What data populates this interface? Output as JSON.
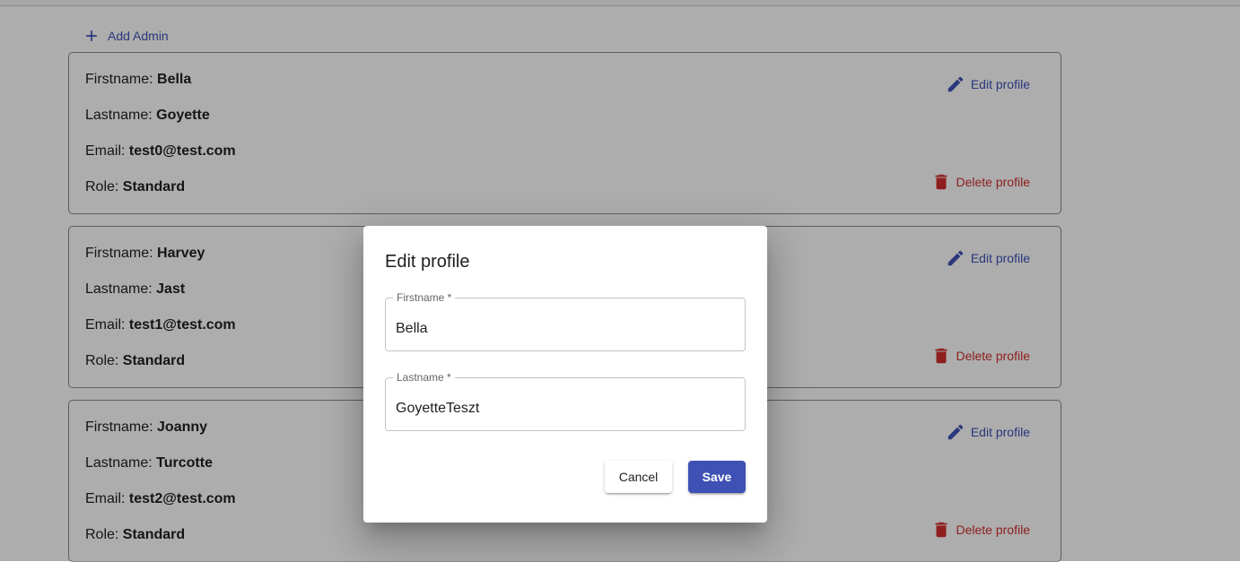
{
  "header": {
    "add_admin_label": "Add Admin"
  },
  "labels": {
    "firstname": "Firstname:",
    "lastname": "Lastname:",
    "email": "Email:",
    "role": "Role:",
    "edit_profile": "Edit profile",
    "delete_profile": "Delete profile"
  },
  "users": [
    {
      "firstname": "Bella",
      "lastname": "Goyette",
      "email": "test0@test.com",
      "role": "Standard"
    },
    {
      "firstname": "Harvey",
      "lastname": "Jast",
      "email": "test1@test.com",
      "role": "Standard"
    },
    {
      "firstname": "Joanny",
      "lastname": "Turcotte",
      "email": "test2@test.com",
      "role": "Standard"
    }
  ],
  "dialog": {
    "title": "Edit profile",
    "firstname_label": "Firstname *",
    "firstname_value": "Bella",
    "lastname_label": "Lastname *",
    "lastname_value": "GoyetteTeszt",
    "cancel_label": "Cancel",
    "save_label": "Save"
  },
  "colors": {
    "primary": "#3f51b5",
    "danger": "#d32f2f",
    "overlay": "rgba(0,0,0,0.32)"
  },
  "icons": {
    "add": "plus-icon",
    "edit": "pencil-icon",
    "delete": "trash-icon"
  }
}
